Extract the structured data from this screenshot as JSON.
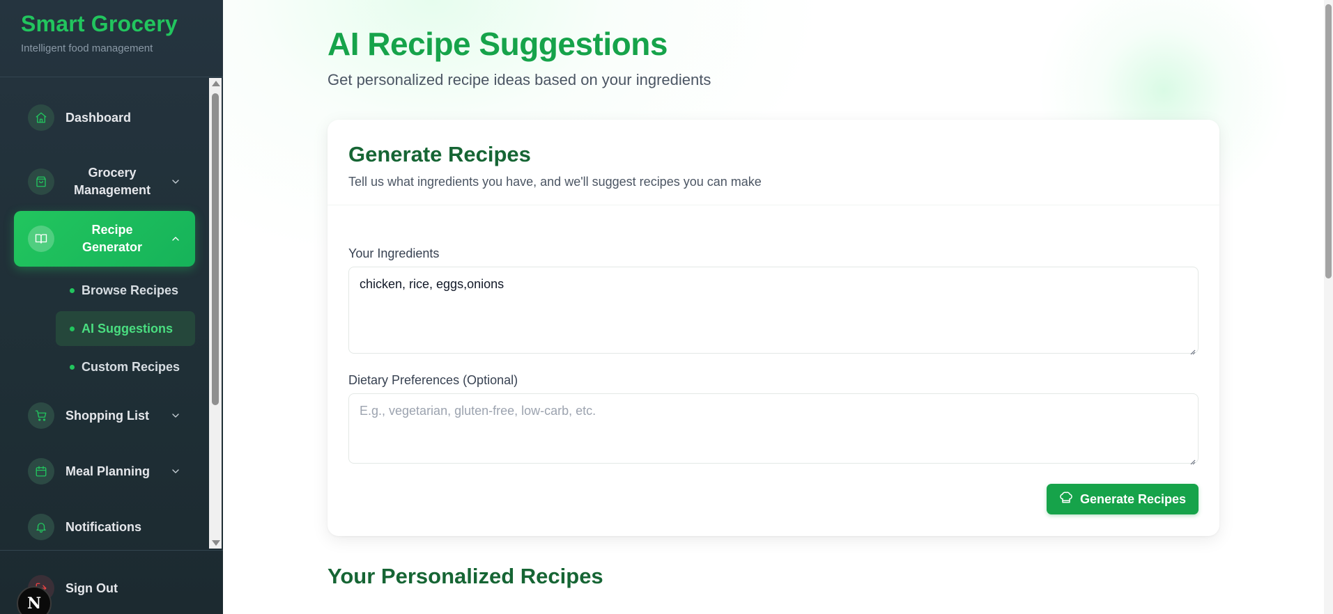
{
  "brand": {
    "title": "Smart Grocery",
    "subtitle": "Intelligent food management"
  },
  "sidebar": {
    "items": [
      {
        "label": "Dashboard",
        "icon": "home-icon"
      },
      {
        "label": "Grocery Management",
        "icon": "shopping-bag-icon",
        "expandable": true
      },
      {
        "label": "Recipe Generator",
        "icon": "book-open-icon",
        "expandable": true,
        "active": true
      },
      {
        "label": "Shopping List",
        "icon": "cart-icon",
        "expandable": true
      },
      {
        "label": "Meal Planning",
        "icon": "calendar-icon",
        "expandable": true
      },
      {
        "label": "Notifications",
        "icon": "bell-icon"
      }
    ],
    "subitems": [
      {
        "label": "Browse Recipes"
      },
      {
        "label": "AI Suggestions",
        "active": true
      },
      {
        "label": "Custom Recipes"
      }
    ],
    "signout": {
      "label": "Sign Out",
      "icon": "log-out-icon"
    },
    "badge": "N"
  },
  "header": {
    "title": "AI Recipe Suggestions",
    "subtitle": "Get personalized recipe ideas based on your ingredients"
  },
  "card": {
    "title": "Generate Recipes",
    "subtitle": "Tell us what ingredients you have, and we'll suggest recipes you can make",
    "ingredients": {
      "label": "Your Ingredients",
      "value": "chicken, rice, eggs,onions"
    },
    "dietary": {
      "label": "Dietary Preferences (Optional)",
      "placeholder": "E.g., vegetarian, gluten-free, low-carb, etc."
    },
    "button_label": "Generate Recipes",
    "button_icon": "chef-hat-icon"
  },
  "results": {
    "title": "Your Personalized Recipes"
  },
  "colors": {
    "accent": "#22c55e",
    "accent_dark": "#16a34a",
    "heading_dark": "#166534",
    "sidebar_bg": "#25343f"
  }
}
